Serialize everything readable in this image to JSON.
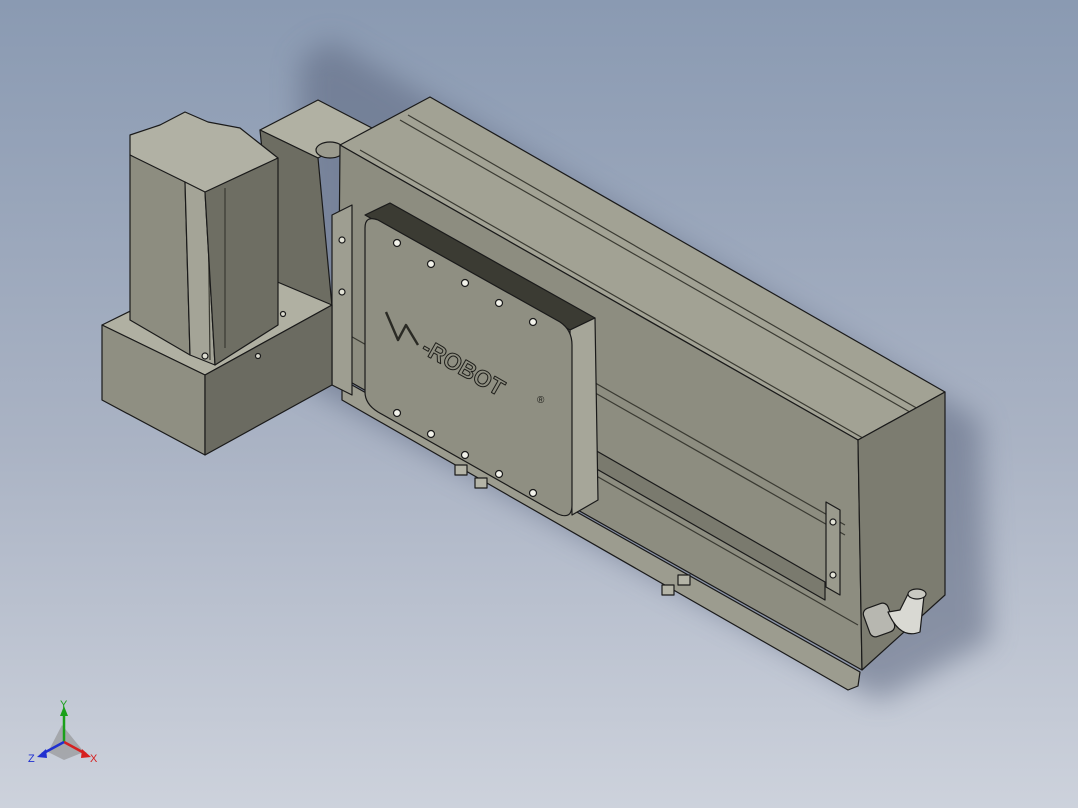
{
  "viewport": {
    "background_top": "#8b9bb3",
    "background_bottom": "#c9ced9",
    "model_color": "#8a8a7c"
  },
  "model": {
    "logo_text": "-ROBOT",
    "registered_mark": "®"
  },
  "triad": {
    "x_label": "X",
    "y_label": "Y",
    "z_label": "Z",
    "x_color": "#d62020",
    "y_color": "#1aa01a",
    "z_color": "#2030d0"
  }
}
